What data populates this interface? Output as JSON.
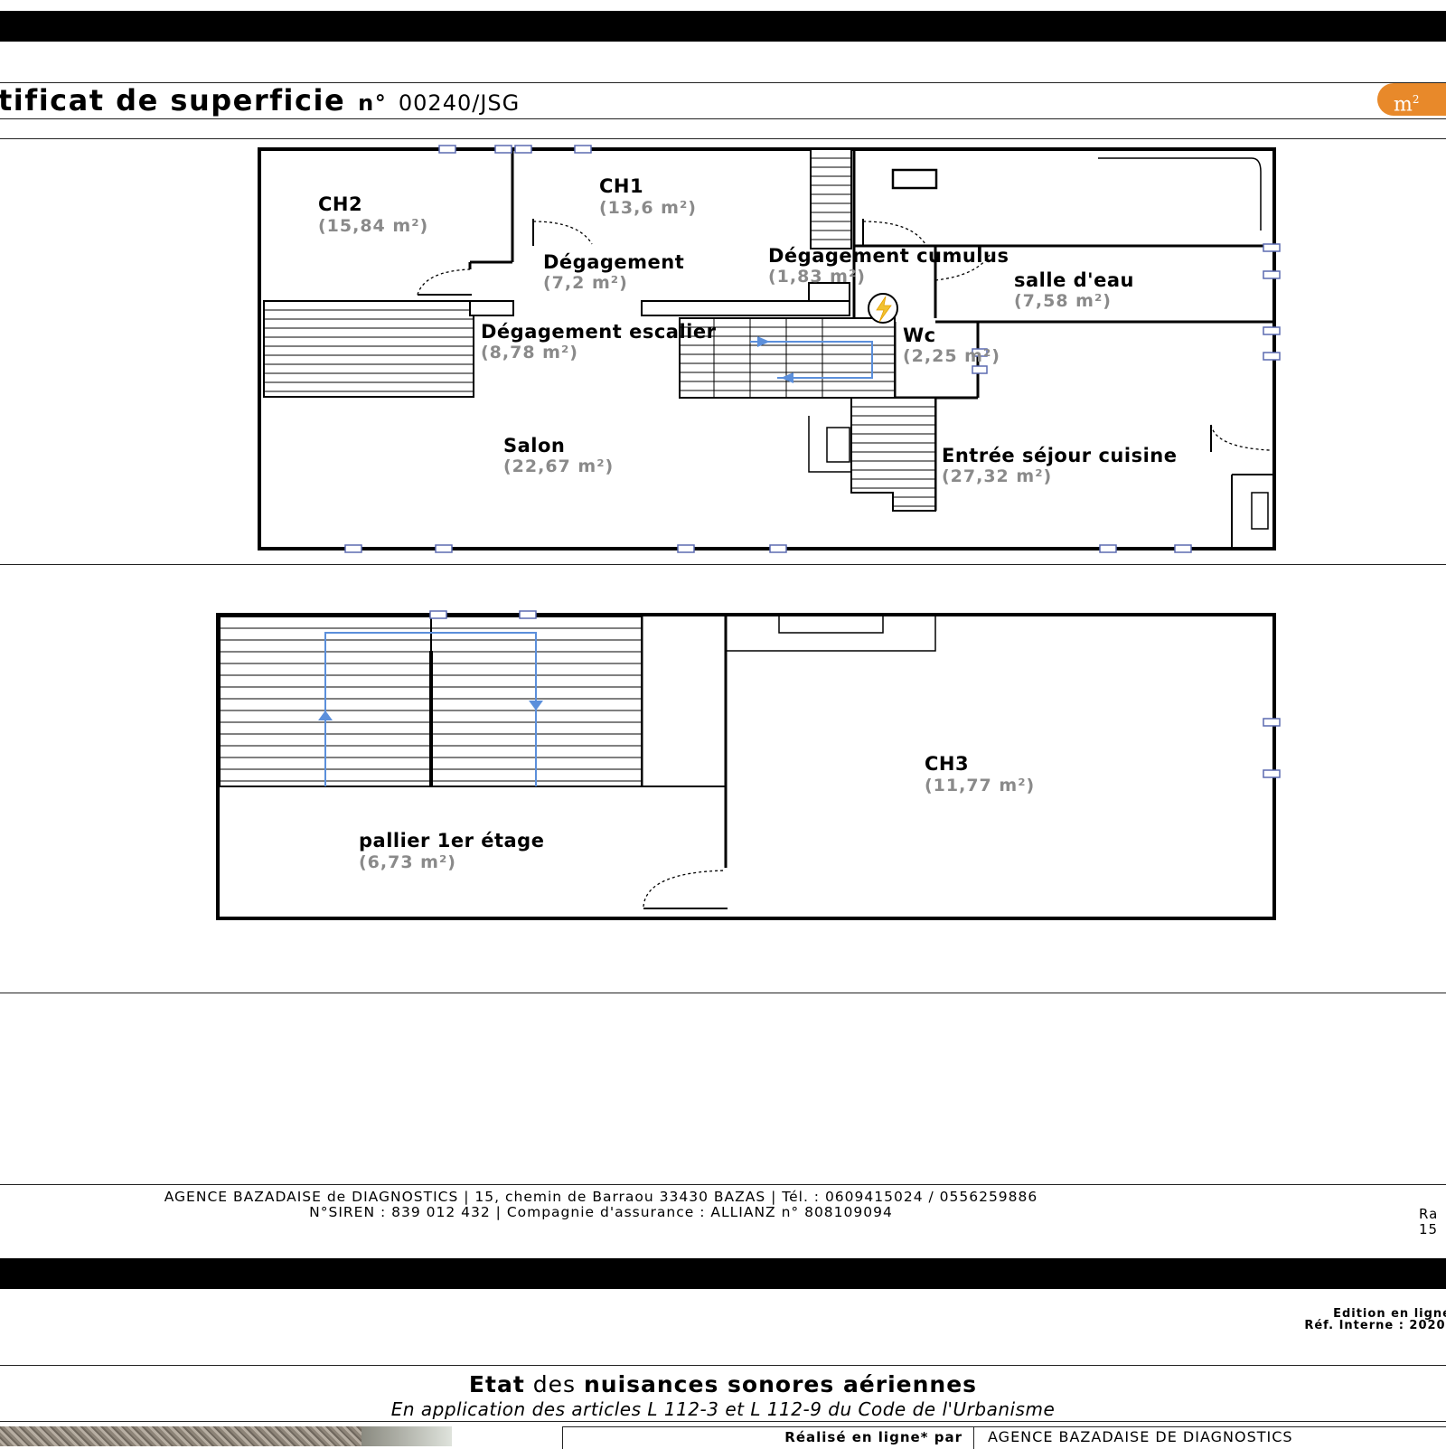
{
  "header": {
    "title": "tificat de superficie",
    "number_prefix": "n°",
    "number": "00240/JSG",
    "logo_text": "m²"
  },
  "plan_ground": {
    "rooms": [
      {
        "name": "CH2",
        "area": "(15,84 m²)"
      },
      {
        "name": "CH1",
        "area": "(13,6 m²)"
      },
      {
        "name": "Dégagement",
        "area": "(7,2 m²)"
      },
      {
        "name": "Dégagement cumulus",
        "area": "(1,83 m²)"
      },
      {
        "name": "salle d'eau",
        "area": "(7,58 m²)"
      },
      {
        "name": "Dégagement escalier",
        "area": "(8,78 m²)"
      },
      {
        "name": "Wc",
        "area": "(2,25 m²)"
      },
      {
        "name": "Salon",
        "area": "(22,67 m²)"
      },
      {
        "name": "Entrée séjour cuisine",
        "area": "(27,32 m²)"
      }
    ]
  },
  "plan_first": {
    "rooms": [
      {
        "name": "CH3",
        "area": "(11,77 m²)"
      },
      {
        "name": "pallier 1er étage",
        "area": "(6,73 m²)"
      }
    ]
  },
  "footer": {
    "line1": "AGENCE BAZADAISE de DIAGNOSTICS | 15, chemin de Barraou 33430 BAZAS | Tél. : 0609415024 / 0556259886",
    "line2": "N°SIREN : 839 012 432 | Compagnie d'assurance : ALLIANZ n° 808109094",
    "right1": "Ra",
    "right2": "15"
  },
  "next_page": {
    "edition": "Edition en ligne",
    "ref": "Réf. Interne : 2020-",
    "title_bold1": "Etat",
    "title_normal": "des",
    "title_bold2": "nuisances sonores aériennes",
    "subtitle": "En application des articles L 112-3 et L 112-9 du Code de l'Urbanisme",
    "table_label": "Réalisé en ligne* par",
    "table_value": "AGENCE BAZADAISE DE DIAGNOSTICS"
  },
  "colors": {
    "logo": "#e8892a",
    "area_text": "#8a8a8a",
    "stair_arrow": "#5b8fdb"
  }
}
